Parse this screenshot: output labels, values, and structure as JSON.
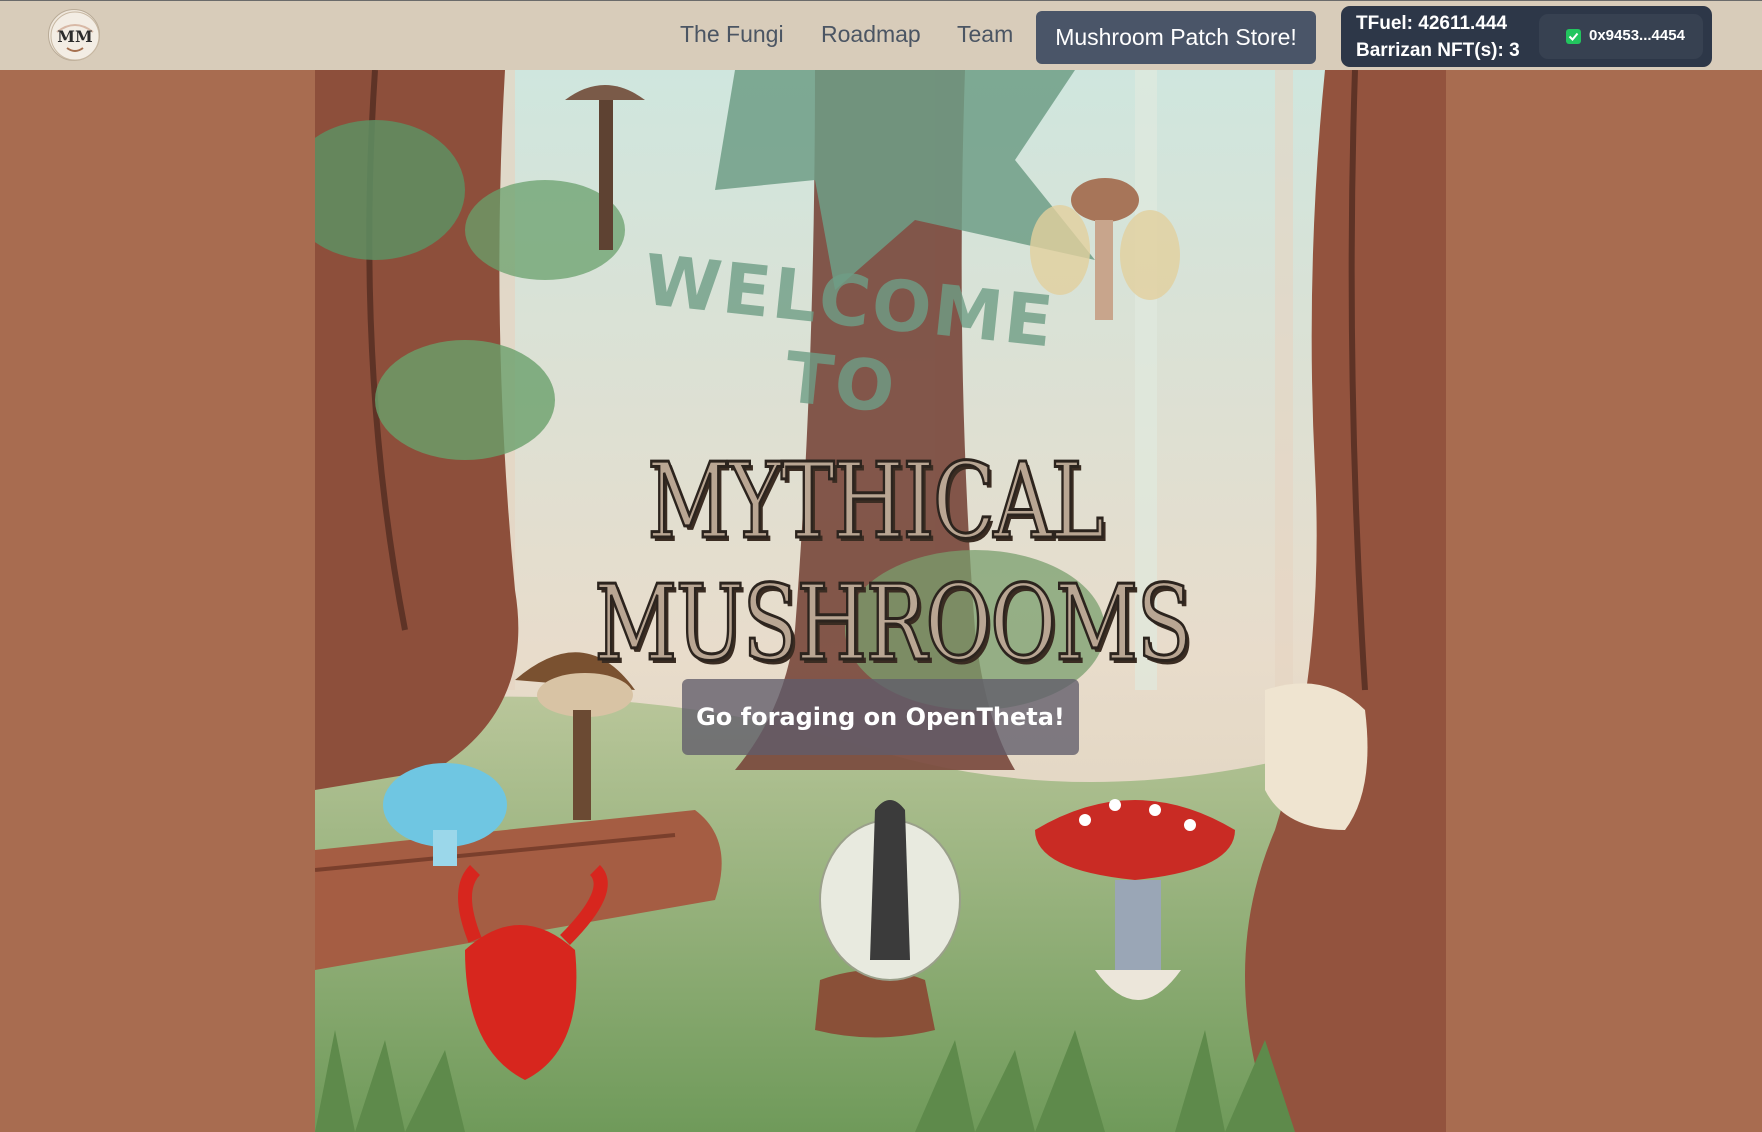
{
  "nav": {
    "links": [
      "The Fungi",
      "Roadmap",
      "Team"
    ],
    "store_button": "Mushroom Patch Store!",
    "logo_text": "MM"
  },
  "wallet": {
    "tfuel": "TFuel: 42611.444",
    "nft": "Barrizan NFT(s): 3",
    "address": "0x9453...4454"
  },
  "hero": {
    "welcome": "WELCOME TO",
    "title": "MYTHICAL MUSHROOMS",
    "cta": "Go foraging on OpenTheta!"
  },
  "colors": {
    "page_background": "#a86c50",
    "navbar_background": "#d8ccba",
    "store_button": "#4a5568",
    "wallet_background": "#2d3748",
    "connected_indicator": "#22c55e"
  },
  "icons": {
    "wallet_status": "check-icon"
  }
}
